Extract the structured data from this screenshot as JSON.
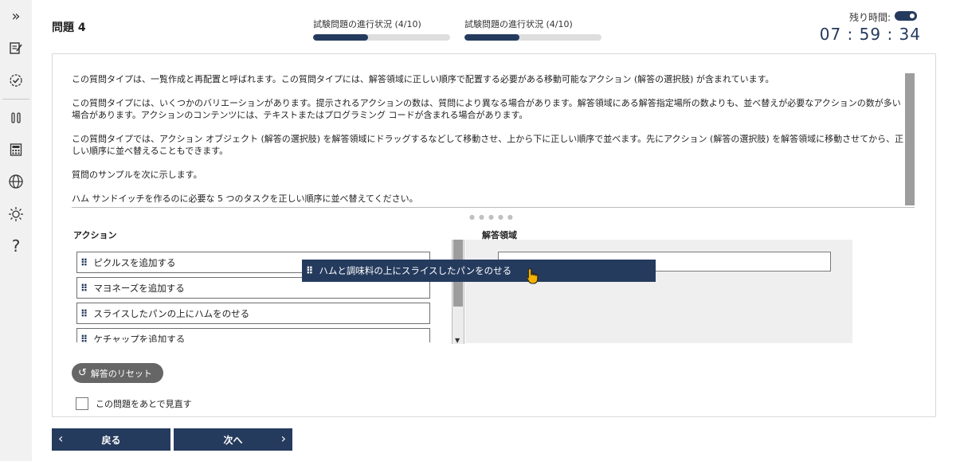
{
  "sidebar": {
    "icons": [
      "double-chevron-right-icon",
      "edit-note-icon",
      "check-circle-icon",
      "pause-icon",
      "calculator-icon",
      "globe-icon",
      "brightness-icon",
      "help-icon"
    ]
  },
  "header": {
    "question_title": "問題 4",
    "progress": [
      {
        "label": "試験問題の進行状況 (4/10)",
        "fraction": 0.4
      },
      {
        "label": "試験問題の進行状況 (4/10)",
        "fraction": 0.4
      }
    ],
    "timer_label": "残り時間:",
    "timer_value": "07 : 59 : 34"
  },
  "description": {
    "paragraphs": [
      "この質問タイプは、一覧作成と再配置と呼ばれます。この質問タイプには、解答領域に正しい順序で配置する必要がある移動可能なアクション (解答の選択肢) が含まれています。",
      "この質問タイプには、いくつかのバリエーションがあります。提示されるアクションの数は、質問により異なる場合があります。解答領域にある解答指定場所の数よりも、並べ替えが必要なアクションの数が多い場合があります。アクションのコンテンツには、テキストまたはプログラミング コードが含まれる場合があります。",
      "この質問タイプでは、アクション オブジェクト (解答の選択肢) を解答領域にドラッグするなどして移動させ、上から下に正しい順序で並べます。先にアクション (解答の選択肢) を解答領域に移動させてから、正しい順序に並べ替えることもできます。",
      "質問のサンプルを次に示します。",
      "ハム サンドイッチを作るのに必要な 5 つのタスクを正しい順序に並べ替えてください。"
    ]
  },
  "actions": {
    "label": "アクション",
    "items": [
      "ピクルスを追加する",
      "マヨネーズを追加する",
      "スライスしたパンの上にハムをのせる",
      "ケチャップを追加する"
    ]
  },
  "answer_area": {
    "label": "解答領域"
  },
  "dragging_item": "ハムと調味料の上にスライスしたパンをのせる",
  "reset_label": "解答のリセット",
  "review_label": "この問題をあとで見直す",
  "nav": {
    "back": "戻る",
    "next": "次へ"
  },
  "colors": {
    "primary": "#253b5e",
    "reset_button": "#666666"
  }
}
